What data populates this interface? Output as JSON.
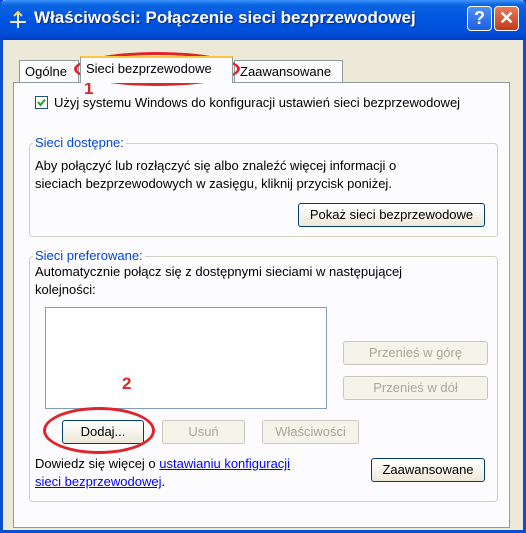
{
  "window": {
    "title": "Właściwości: Połączenie sieci bezprzewodowej",
    "help_label": "?",
    "close_label": "✕"
  },
  "tabs": [
    {
      "label": "Ogólne",
      "active": false
    },
    {
      "label": "Sieci bezprzewodowe",
      "active": true
    },
    {
      "label": "Zaawansowane",
      "active": false
    }
  ],
  "checkbox": {
    "label": "Użyj systemu Windows do konfiguracji ustawień sieci bezprzewodowej",
    "checked": true
  },
  "available": {
    "legend": "Sieci dostępne:",
    "description_line1": "Aby połączyć lub rozłączyć się albo znaleźć więcej informacji o",
    "description_line2": "sieciach bezprzewodowych w zasięgu, kliknij przycisk poniżej.",
    "show_button": "Pokaż sieci bezprzewodowe"
  },
  "preferred": {
    "legend": "Sieci preferowane:",
    "description_line1": "Automatycznie połącz się z dostępnymi sieciami w następującej",
    "description_line2": "kolejności:",
    "move_up": "Przenieś w górę",
    "move_down": "Przenieś w dół",
    "add": "Dodaj...",
    "remove": "Usuń",
    "properties": "Właściwości"
  },
  "footer": {
    "text_prefix": "Dowiedz się więcej o ",
    "link_line1": "ustawianiu konfiguracji",
    "link_line2": "sieci bezprzewodowej",
    "text_suffix": ".",
    "advanced_button": "Zaawansowane"
  },
  "annotations": {
    "step1": "1",
    "step2": "2",
    "color": "#e0242b"
  },
  "colors": {
    "titlebar": "#0054e3",
    "group_legend": "#0046d5",
    "link": "#0000ff"
  }
}
